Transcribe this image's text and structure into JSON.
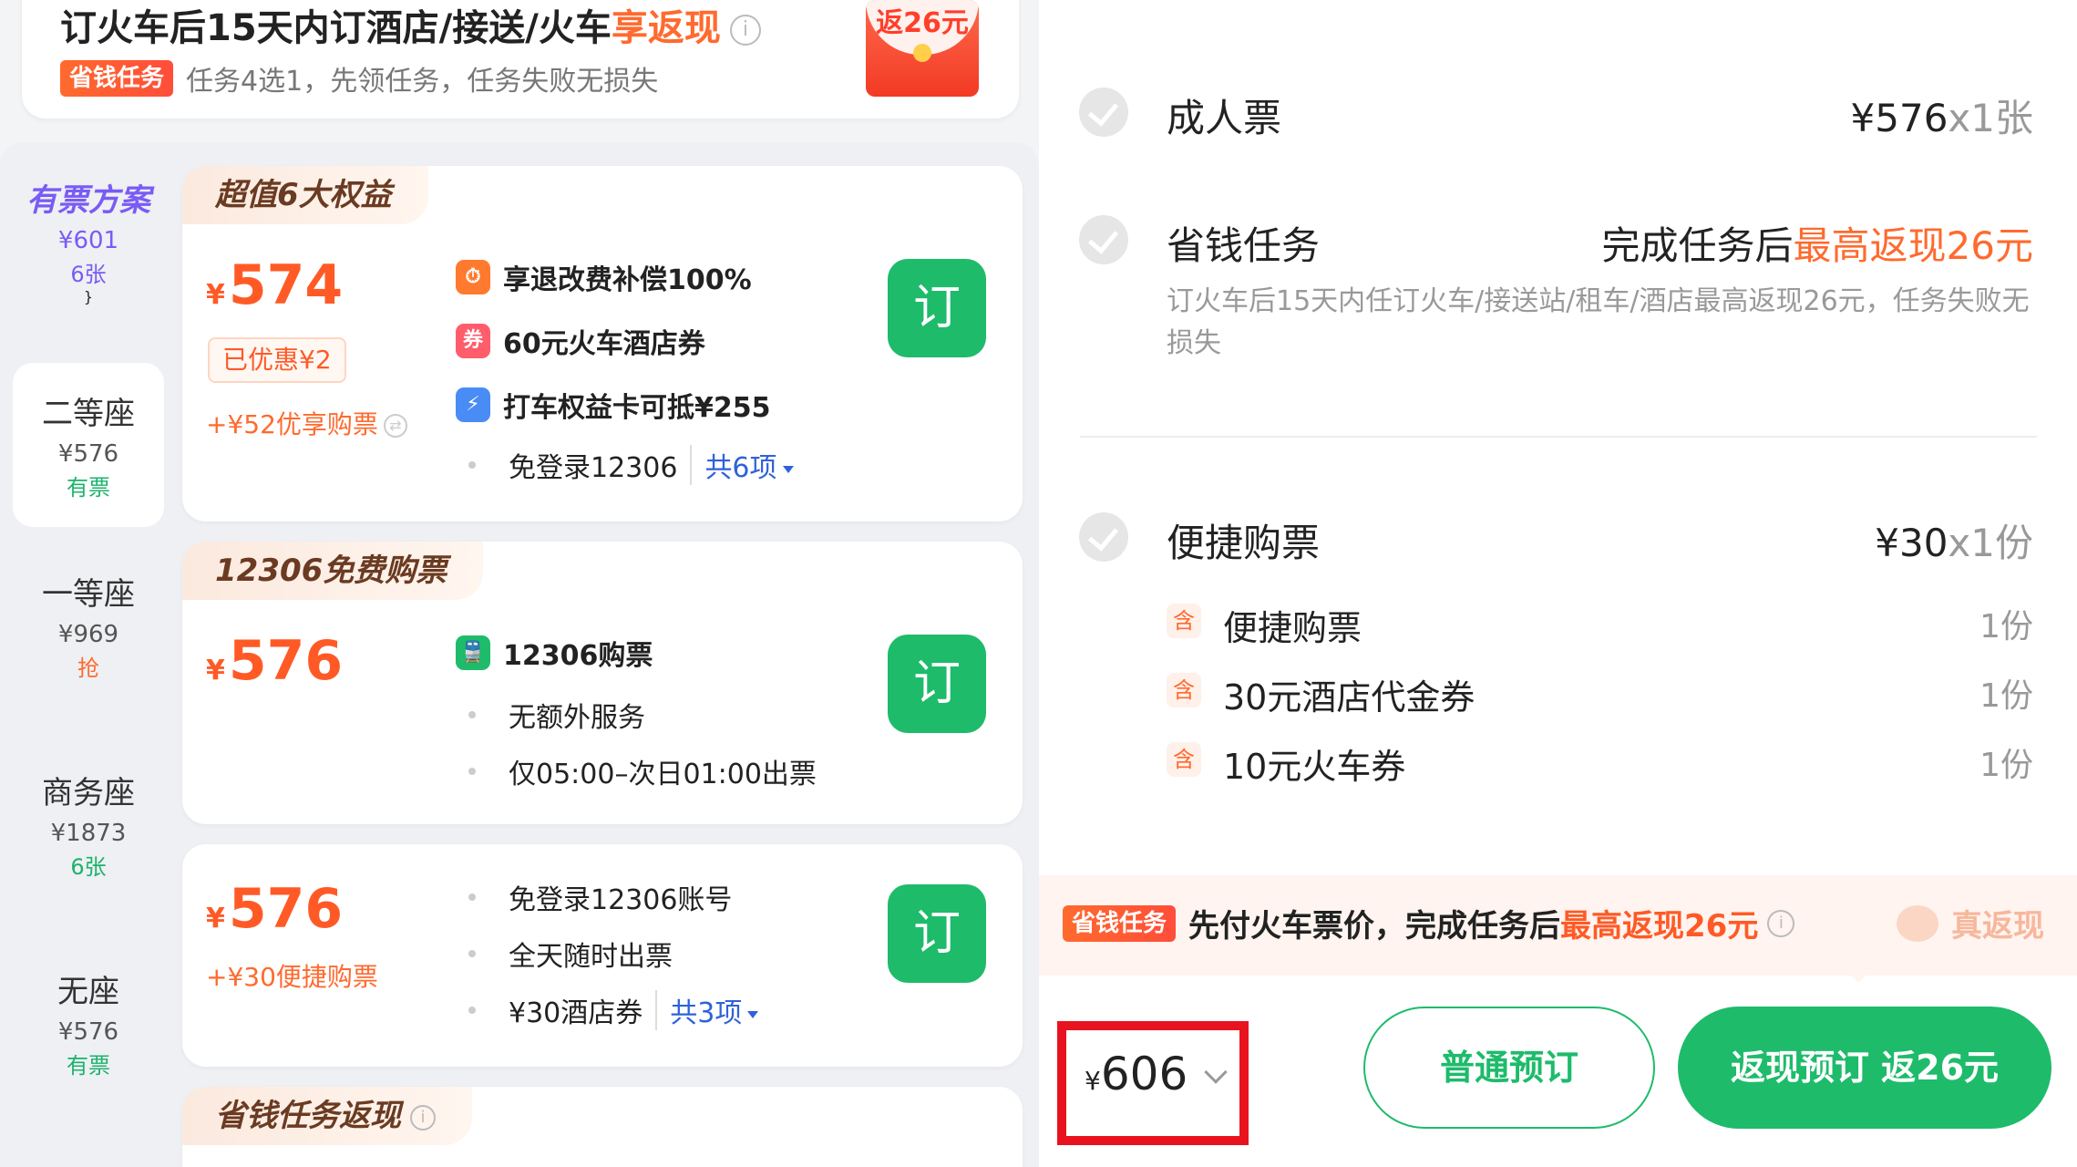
{
  "banner": {
    "title_prefix": "订火车后15天内订酒店/接送/火车",
    "title_highlight": "享返现",
    "info_icon": "ⓘ",
    "tag": "省钱任务",
    "subtitle": "任务4选1，先领任务，任务失败无损失",
    "redpacket_label": "返26元"
  },
  "sidebar": {
    "items": [
      {
        "name": "有票方案",
        "price": "¥601",
        "status": "6张"
      },
      {
        "name": "二等座",
        "price": "¥576",
        "status": "有票"
      },
      {
        "name": "一等座",
        "price": "¥969",
        "status": "抢"
      },
      {
        "name": "商务座",
        "price": "¥1873",
        "status": "6张"
      },
      {
        "name": "无座",
        "price": "¥576",
        "status": "有票"
      }
    ]
  },
  "cards": [
    {
      "head": "超值6大权益",
      "yen": "¥",
      "price": "574",
      "saved": "已优惠¥2",
      "extra": "+¥52优享购票",
      "features": [
        {
          "icon_text": "⏱",
          "text": "享退改费补偿100%"
        },
        {
          "icon_text": "券",
          "text": "60元火车酒店券"
        },
        {
          "icon_text": "⚡",
          "text": "打车权益卡可抵¥255"
        },
        {
          "text": "免登录12306"
        }
      ],
      "more": "共6项",
      "book": "订"
    },
    {
      "head": "12306免费购票",
      "yen": "¥",
      "price": "576",
      "features": [
        {
          "icon_text": "🚆",
          "text": "12306购票"
        },
        {
          "text": "无额外服务"
        },
        {
          "text": "仅05:00–次日01:00出票"
        }
      ],
      "book": "订"
    },
    {
      "yen": "¥",
      "price": "576",
      "extra": "+¥30便捷购票",
      "features": [
        {
          "text": "免登录12306账号"
        },
        {
          "text": "全天随时出票"
        },
        {
          "text": "¥30酒店券"
        }
      ],
      "more": "共3项",
      "book": "订"
    },
    {
      "head": "省钱任务返现",
      "info_icon": "i"
    }
  ],
  "summary": {
    "adult": {
      "label": "成人票",
      "price": "¥576",
      "mult": "x1张"
    },
    "task": {
      "label": "省钱任务",
      "prefix": "完成任务后",
      "highlight": "最高返现26元",
      "desc": "订火车后15天内任订火车/接送站/租车/酒店最高返现26元，任务失败无损失"
    },
    "quick": {
      "label": "便捷购票",
      "price": "¥30",
      "mult": "x1份",
      "includes_icon": "含",
      "items": [
        {
          "name": "便捷购票",
          "qty": "1份"
        },
        {
          "name": "30元酒店代金券",
          "qty": "1份"
        },
        {
          "name": "10元火车券",
          "qty": "1份"
        }
      ]
    }
  },
  "strip": {
    "tag": "省钱任务",
    "text_prefix": "先付火车票价，完成任务后",
    "text_highlight": "最高返现26元",
    "info_icon": "i",
    "true_refund": "真返现"
  },
  "footer": {
    "yen": "¥",
    "total": "606",
    "btn_normal": "普通预订",
    "btn_cash": "返现预订  返26元"
  },
  "colors": {
    "accent_green": "#1ebb6b",
    "accent_orange": "#ff6a2e",
    "price_red": "#ff5a26",
    "highlight_box": "#e8131e",
    "recommend_purple": "#7a5bf5"
  }
}
